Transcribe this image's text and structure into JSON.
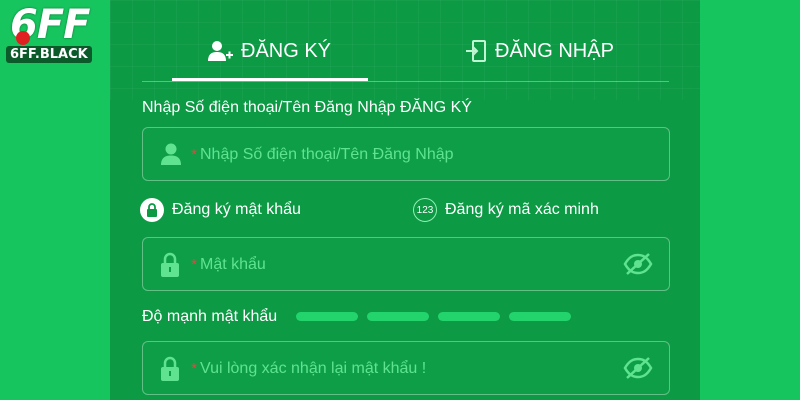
{
  "logo": {
    "big": "6FF",
    "sub": "6FF.BLACK"
  },
  "tabs": {
    "register": "ĐĂNG KÝ",
    "login": "ĐĂNG NHẬP"
  },
  "username": {
    "label": "Nhập Số điện thoại/Tên Đăng Nhập ĐĂNG KÝ",
    "required_mark": "*",
    "placeholder": "Nhập Số điện thoại/Tên Đăng Nhập"
  },
  "options": {
    "password_option": "Đăng ký mật khẩu",
    "code_option": "Đăng ký mã xác minh",
    "code_badge": "123"
  },
  "password": {
    "required_mark": "*",
    "placeholder": "Mật khẩu"
  },
  "strength": {
    "label": "Độ mạnh mật khẩu"
  },
  "confirm": {
    "required_mark": "*",
    "placeholder": "Vui lòng xác nhận lại mật khẩu !"
  },
  "colors": {
    "background": "#0fc25a",
    "panel": "#0c9a45",
    "placeholder": "#5fe391",
    "required": "#ff3b3b"
  },
  "icons": {
    "register_tab": "user-plus-icon",
    "login_tab": "login-door-icon",
    "username_field": "user-icon",
    "password_field": "lock-icon",
    "toggle_visibility": "eye-off-icon"
  }
}
